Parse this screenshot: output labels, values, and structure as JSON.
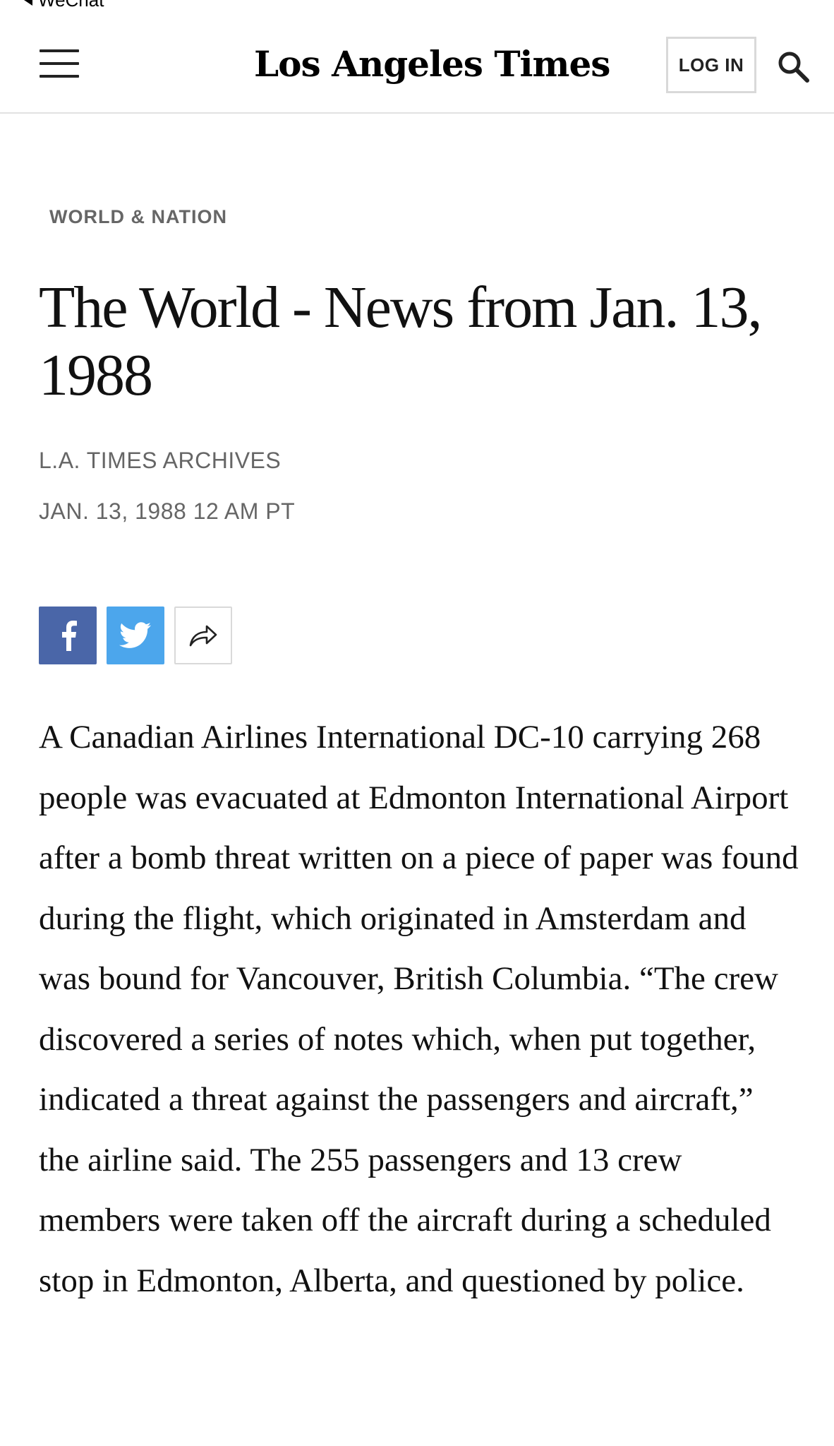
{
  "status_bar": {
    "back_app_label": "WeChat"
  },
  "header": {
    "masthead": "Los Angeles Times",
    "login_label": "LOG IN",
    "menu_icon": "hamburger-menu-icon",
    "search_icon": "search-icon"
  },
  "article": {
    "section": "WORLD & NATION",
    "headline": "The World - News from Jan. 13, 1988",
    "byline": "L.A. TIMES ARCHIVES",
    "date": "JAN. 13, 1988 12 AM PT",
    "body": "A Canadian Airlines International DC-10 carrying 268 people was evacuated at Edmonton International Airport after a bomb threat written on a piece of paper was found during the flight, which originated in Amsterdam and was bound for Vancouver, British Columbia. “The crew discovered a series of notes which, when put together, indicated a threat against the passengers and aircraft,” the airline said. The 255 passengers and 13 crew members were taken off the aircraft during a scheduled stop in Edmonton, Alberta, and questioned by police."
  },
  "share": {
    "facebook_icon": "facebook-icon",
    "twitter_icon": "twitter-icon",
    "share_icon": "share-arrow-icon"
  },
  "colors": {
    "facebook": "#4a66a8",
    "twitter": "#4ca6ec",
    "meta_text": "#666666",
    "divider": "#e2e2e2"
  }
}
